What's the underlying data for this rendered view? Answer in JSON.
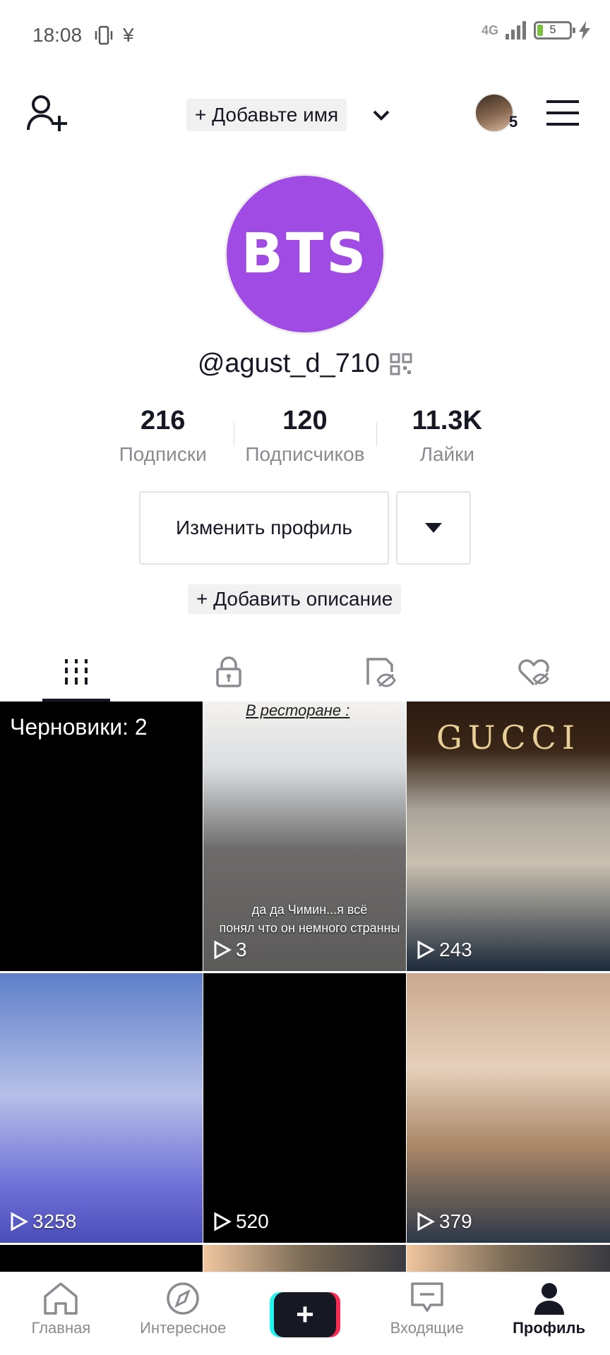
{
  "status_bar": {
    "time": "18:08",
    "currency_icon": "¥",
    "network": "4G",
    "battery": "5"
  },
  "top_nav": {
    "add_name_label": "+ Добавьте имя",
    "follow_requests_count": "5"
  },
  "profile": {
    "avatar_text": "BTS",
    "avatar_color": "#a04be3",
    "username": "@agust_d_710",
    "stats": [
      {
        "value": "216",
        "label": "Подписки"
      },
      {
        "value": "120",
        "label": "Подписчиков"
      },
      {
        "value": "11.3K",
        "label": "Лайки"
      }
    ],
    "edit_button": "Изменить профиль",
    "add_description": "+ Добавить описание"
  },
  "tabs": [
    "videos-grid-icon",
    "lock-icon",
    "hidden-icon",
    "liked-icon"
  ],
  "videos": [
    {
      "draft_label": "Черновики: 2"
    },
    {
      "caption": "В ресторане :",
      "subtitle_1": "да да Чимин...я всё",
      "subtitle_2": "понял что он немного странны",
      "views": "3"
    },
    {
      "brand": "GUCCI",
      "views": "243"
    },
    {
      "views": "3258"
    },
    {
      "views": "520"
    },
    {
      "views": "379"
    }
  ],
  "bottom_nav": [
    {
      "label": "Главная",
      "icon": "home-icon"
    },
    {
      "label": "Интересное",
      "icon": "compass-icon"
    },
    {
      "label": "+",
      "icon": "create-icon"
    },
    {
      "label": "Входящие",
      "icon": "inbox-icon"
    },
    {
      "label": "Профиль",
      "icon": "profile-icon"
    }
  ],
  "colors": {
    "accent_cyan": "#25f4ee",
    "accent_red": "#fe2c55",
    "text_primary": "#161823",
    "text_secondary": "#8a8b91"
  }
}
